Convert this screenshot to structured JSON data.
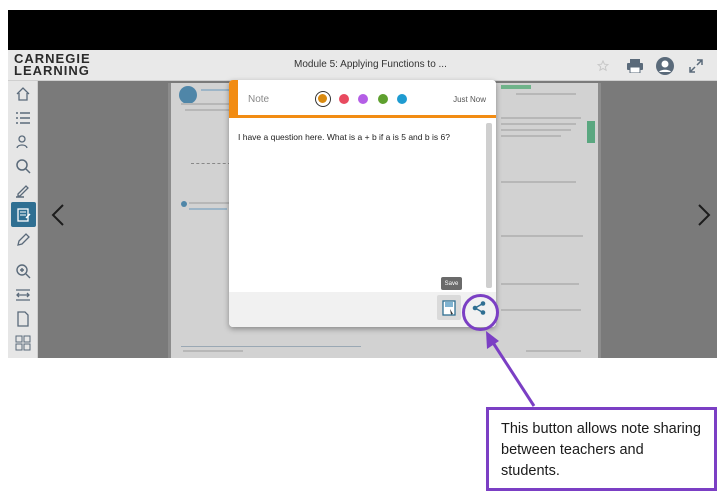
{
  "header": {
    "logo_line1": "CARNEGIE",
    "logo_line2": "LEARNING",
    "module_title": "Module 5: Applying Functions to ...",
    "icons": [
      "print-icon",
      "profile-icon",
      "expand-icon"
    ]
  },
  "sidebar": {
    "icons": [
      "home-icon",
      "list-icon",
      "glossary-icon",
      "search-icon",
      "highlighter-icon",
      "notes-icon",
      "pen-icon",
      "zoom-in-icon",
      "fit-width-icon",
      "page-icon",
      "thumbnails-icon"
    ],
    "active": "notes-icon"
  },
  "note": {
    "label": "Note",
    "time": "Just Now",
    "colors": [
      "#d98a10",
      "#e84a5f",
      "#b45ee6",
      "#5ea02e",
      "#1e9bd1"
    ],
    "selected_color": "#d98a10",
    "accent": "#f28c13",
    "text": "I have a question here.  What is a + b if a is 5 and b is 6?",
    "save_tooltip": "Save"
  },
  "callout": {
    "text": "This button allows note sharing between teachers and students.",
    "color": "#7b3fc4"
  }
}
